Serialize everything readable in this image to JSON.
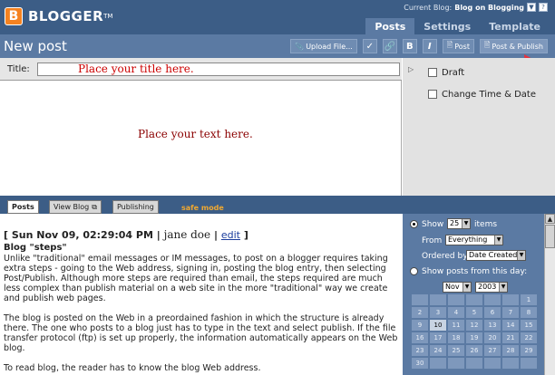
{
  "header": {
    "logo_letter": "B",
    "logo_text": "BLOGGER",
    "logo_tm": "TM",
    "current_blog_label": "Current Blog:",
    "current_blog_name": "Blog on Blogging"
  },
  "tabs": [
    {
      "label": "Posts"
    },
    {
      "label": "Settings"
    },
    {
      "label": "Template"
    }
  ],
  "toolbar": {
    "page_title": "New post",
    "upload_label": "Upload File...",
    "bold_label": "B",
    "italic_label": "I",
    "post_label": "Post",
    "post_publish_label": "Post & Publish"
  },
  "editor": {
    "title_label": "Title:",
    "title_placeholder": "Place your title here.",
    "body_placeholder": "Place your text here."
  },
  "options": {
    "draft_label": "Draft",
    "change_time_label": "Change Time & Date"
  },
  "bottom_tabs": [
    {
      "label": "Posts"
    },
    {
      "label": "View Blog"
    },
    {
      "label": "Publishing"
    }
  ],
  "safe_mode": "safe mode",
  "post": {
    "date": "[ Sun Nov 09, 02:29:04 PM |",
    "author": "jane doe",
    "separator": "|",
    "edit_label": "edit",
    "close_bracket": "]",
    "heading": "Blog \"steps\"",
    "paragraphs": [
      "Unlike \"traditional\" email messages or IM messages, to post on a blogger requires taking extra steps - going to the Web address, signing in, posting the blog entry, then selecting Post/Publish. Although more steps are required than email, the steps required are much less complex than publish material on a web site in the more \"traditional\" way we create and publish web pages.",
      "The blog is posted on the Web in a preordained fashion in which the structure is already there. The one who posts to a blog just has to type in the text and select publish. If the file transfer protocol (ftp) is set up properly, the information automatically appears on the Web blog.",
      "To read blog, the reader has to know the blog Web address."
    ]
  },
  "filter": {
    "show_label": "Show",
    "show_count": "25",
    "items_label": "items",
    "from_label": "From",
    "from_value": "Everything",
    "ordered_label": "Ordered by",
    "ordered_value": "Date Created",
    "show_day_label": "Show posts from this day:",
    "month_value": "Nov",
    "year_value": "2003",
    "calendar_rows": [
      [
        "",
        "",
        "",
        "",
        "",
        "",
        "1"
      ],
      [
        "2",
        "3",
        "4",
        "5",
        "6",
        "7",
        "8"
      ],
      [
        "9",
        "10",
        "11",
        "12",
        "13",
        "14",
        "15"
      ],
      [
        "16",
        "17",
        "18",
        "19",
        "20",
        "21",
        "22"
      ],
      [
        "23",
        "24",
        "25",
        "26",
        "27",
        "28",
        "29"
      ],
      [
        "30",
        "",
        "",
        "",
        "",
        "",
        ""
      ]
    ]
  }
}
